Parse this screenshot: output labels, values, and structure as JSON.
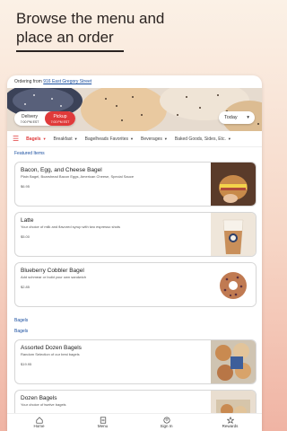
{
  "promo": {
    "headline": "Browse the menu and place an order"
  },
  "ordering": {
    "prefix": "Ordering from",
    "address": "916 East Gregory Street"
  },
  "mode": [
    {
      "label": "Delivery",
      "sub": "7:00 PM EST",
      "active": false
    },
    {
      "label": "Pickup",
      "sub": "7:00 PM EST",
      "active": true
    }
  ],
  "day_select": {
    "value": "Today"
  },
  "categories": [
    {
      "label": "Bagels",
      "active": true
    },
    {
      "label": "Breakfast",
      "active": false
    },
    {
      "label": "Bagelheads Favorites",
      "active": false
    },
    {
      "label": "Beverages",
      "active": false
    },
    {
      "label": "Baked Goods, Sides, Etc.",
      "active": false
    }
  ],
  "sections": {
    "featured": "Featured Items",
    "bagels_1": "Bagels",
    "bagels_2": "Bagels"
  },
  "items": [
    {
      "title": "Bacon, Egg, and Cheese Bagel",
      "desc": "Plain Bagel, Boarshead Bacon Eggs, American Cheese, Special Sauce",
      "price": "$6.95",
      "icon": "sandwich-photo"
    },
    {
      "title": "Latte",
      "desc": "Your choice of milk and flavored syrup with two espresso shots",
      "price": "$5.00",
      "icon": "latte-photo"
    },
    {
      "title": "Blueberry Cobbler Bagel",
      "desc": "Add schmear or build your own sandwich",
      "price": "$2.85",
      "icon": "blueberry-bagel-photo"
    },
    {
      "title": "Assorted Dozen Bagels",
      "desc": "Random Selection of our best bagels",
      "price": "$19.95",
      "icon": "dozen-bagels-photo"
    },
    {
      "title": "Dozen Bagels",
      "desc": "Your choice of twelve bagels",
      "price": "",
      "icon": "dozen-bagels-box-photo"
    }
  ],
  "tabs": [
    {
      "label": "Home",
      "icon": "home-icon"
    },
    {
      "label": "Menu",
      "icon": "menu-icon"
    },
    {
      "label": "Sign In",
      "icon": "person-icon"
    },
    {
      "label": "Rewards",
      "icon": "star-icon"
    }
  ],
  "colors": {
    "accent": "#e03a3a",
    "link": "#1a4fa0"
  }
}
